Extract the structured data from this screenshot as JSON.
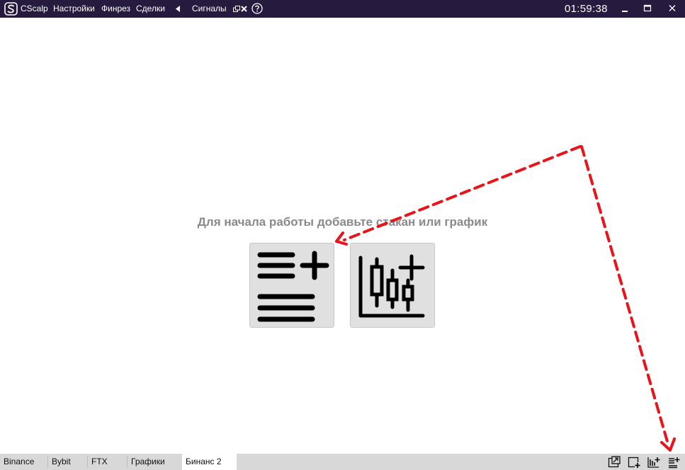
{
  "titlebar": {
    "app_name": "CScalp",
    "menu": [
      "Настройки",
      "Финрез",
      "Сделки"
    ],
    "signals_label": "Сигналы",
    "clock": "01:59:38"
  },
  "main": {
    "hint": "Для начала работы добавьте стакан или график"
  },
  "bottom_tabs": [
    {
      "label": "Binance",
      "active": false
    },
    {
      "label": "Bybit",
      "active": false
    },
    {
      "label": "FTX",
      "active": false
    },
    {
      "label": "Графики",
      "active": false
    },
    {
      "label": "Бинанс 2",
      "active": true
    }
  ],
  "colors": {
    "titlebar": "#261a3f",
    "annotation_arrow": "#e8141c",
    "button_bg": "#e0e0e0",
    "hint_text": "#8a8a8a"
  },
  "icons": {
    "add_orderbook": "list-plus-icon",
    "add_chart": "candlestick-plus-icon"
  }
}
